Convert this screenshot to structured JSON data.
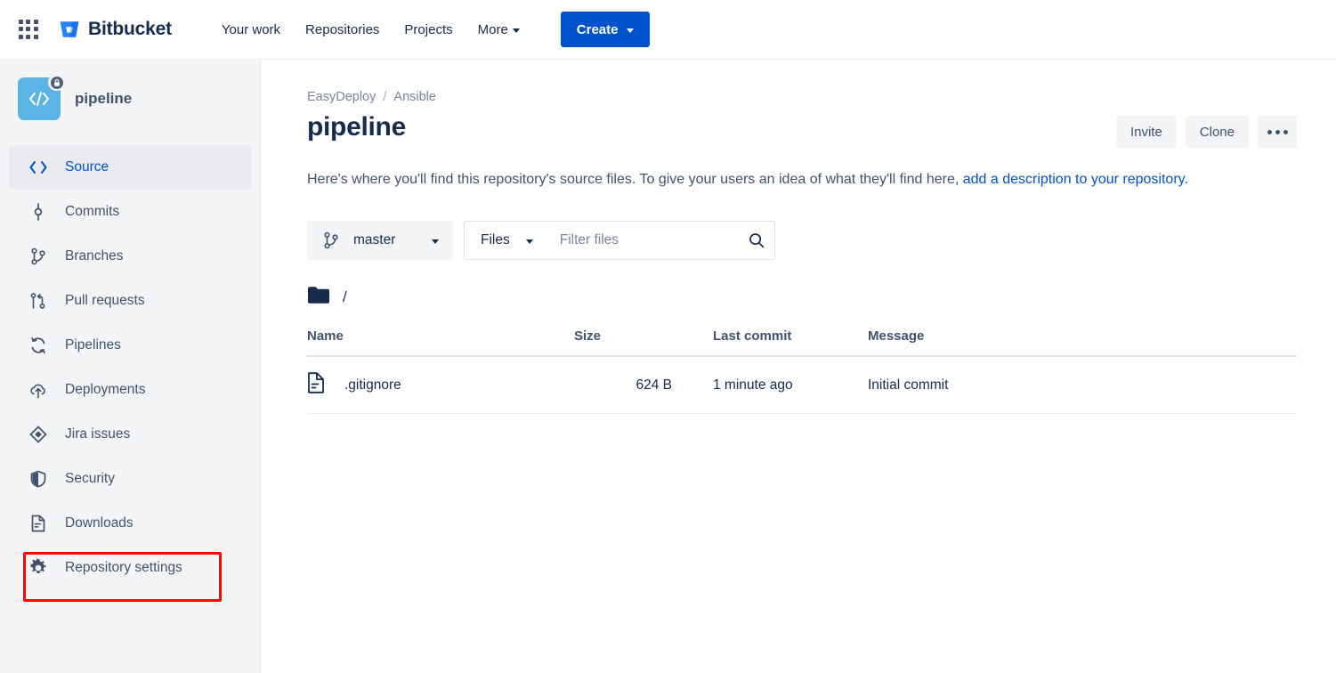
{
  "topnav": {
    "app_switcher_icon": "grid-apps-icon",
    "brand": "Bitbucket",
    "links": [
      {
        "label": "Your work",
        "has_caret": false
      },
      {
        "label": "Repositories",
        "has_caret": false
      },
      {
        "label": "Projects",
        "has_caret": false
      },
      {
        "label": "More",
        "has_caret": true
      }
    ],
    "create_label": "Create",
    "create_color": "#0052CC"
  },
  "sidebar": {
    "repo_name": "pipeline",
    "repo_private": true,
    "items": [
      {
        "label": "Source",
        "icon": "code-brackets-icon",
        "active": true,
        "highlighted": false
      },
      {
        "label": "Commits",
        "icon": "commit-icon",
        "active": false,
        "highlighted": false
      },
      {
        "label": "Branches",
        "icon": "branch-icon",
        "active": false,
        "highlighted": false
      },
      {
        "label": "Pull requests",
        "icon": "pull-request-icon",
        "active": false,
        "highlighted": false
      },
      {
        "label": "Pipelines",
        "icon": "pipelines-icon",
        "active": false,
        "highlighted": false
      },
      {
        "label": "Deployments",
        "icon": "deployments-icon",
        "active": false,
        "highlighted": false
      },
      {
        "label": "Jira issues",
        "icon": "jira-icon",
        "active": false,
        "highlighted": false
      },
      {
        "label": "Security",
        "icon": "shield-icon",
        "active": false,
        "highlighted": false
      },
      {
        "label": "Downloads",
        "icon": "downloads-icon",
        "active": false,
        "highlighted": false
      },
      {
        "label": "Repository settings",
        "icon": "gear-icon",
        "active": false,
        "highlighted": true
      }
    ],
    "highlight_color": "#FF0000"
  },
  "main": {
    "breadcrumb": {
      "workspace": "EasyDeploy",
      "separator": "/",
      "project": "Ansible"
    },
    "title": "pipeline",
    "actions": {
      "invite": "Invite",
      "clone": "Clone",
      "more_icon": "ellipsis-icon"
    },
    "description": {
      "text": "Here's where you'll find this repository's source files. To give your users an idea of what they'll find here, ",
      "link": "add a description to your repository.",
      "link_color": "#0052CC"
    },
    "toolbar": {
      "branch": "master",
      "branch_icon": "branch-icon",
      "files_select": "Files",
      "filter_placeholder": "Filter files",
      "filter_value": "",
      "search_icon": "search-icon"
    },
    "path": {
      "folder_icon": "folder-icon",
      "current": "/"
    },
    "table": {
      "headers": [
        "Name",
        "Size",
        "Last commit",
        "Message"
      ],
      "rows": [
        {
          "icon": "file-icon",
          "name": ".gitignore",
          "size": "624 B",
          "last_commit": "1 minute ago",
          "message": "Initial commit"
        }
      ]
    }
  }
}
